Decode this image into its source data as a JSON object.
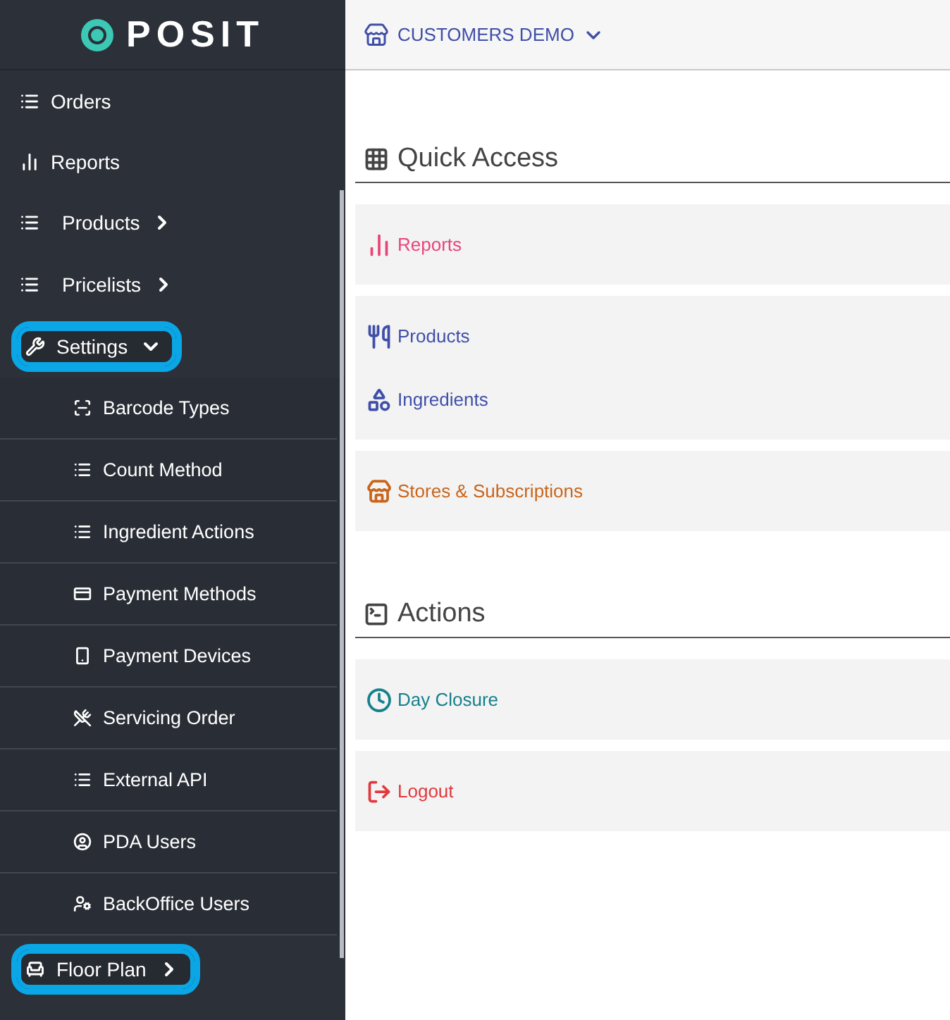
{
  "sidebar": {
    "logo": "POSIT",
    "items": [
      {
        "label": "Orders",
        "kind": "link",
        "highlighted": false
      },
      {
        "label": "Reports",
        "kind": "link",
        "highlighted": false
      },
      {
        "label": "Products",
        "kind": "group",
        "expanded": false,
        "highlighted": false
      },
      {
        "label": "Pricelists",
        "kind": "group",
        "expanded": false,
        "highlighted": false
      },
      {
        "label": "Settings",
        "kind": "group",
        "expanded": true,
        "highlighted": true,
        "children": [
          {
            "label": "Barcode Types"
          },
          {
            "label": "Count Method"
          },
          {
            "label": "Ingredient Actions"
          },
          {
            "label": "Payment Methods"
          },
          {
            "label": "Payment Devices"
          },
          {
            "label": "Servicing Order"
          },
          {
            "label": "External API"
          },
          {
            "label": "PDA Users"
          },
          {
            "label": "BackOffice Users"
          }
        ]
      },
      {
        "label": "Floor Plan",
        "kind": "group",
        "expanded": false,
        "highlighted": true
      }
    ]
  },
  "header": {
    "store": "CUSTOMERS DEMO"
  },
  "sections": [
    {
      "title": "Quick Access",
      "cards": [
        [
          {
            "label": "Reports",
            "color": "#e8457a"
          }
        ],
        [
          {
            "label": "Products",
            "color": "#3f4fa8"
          },
          {
            "label": "Ingredients",
            "color": "#3f4fa8"
          }
        ],
        [
          {
            "label": "Stores & Subscriptions",
            "color": "#c9651c"
          }
        ]
      ]
    },
    {
      "title": "Actions",
      "cards": [
        [
          {
            "label": "Day Closure",
            "color": "#16808c"
          }
        ],
        [
          {
            "label": "Logout",
            "color": "#e0393e"
          }
        ]
      ]
    }
  ]
}
